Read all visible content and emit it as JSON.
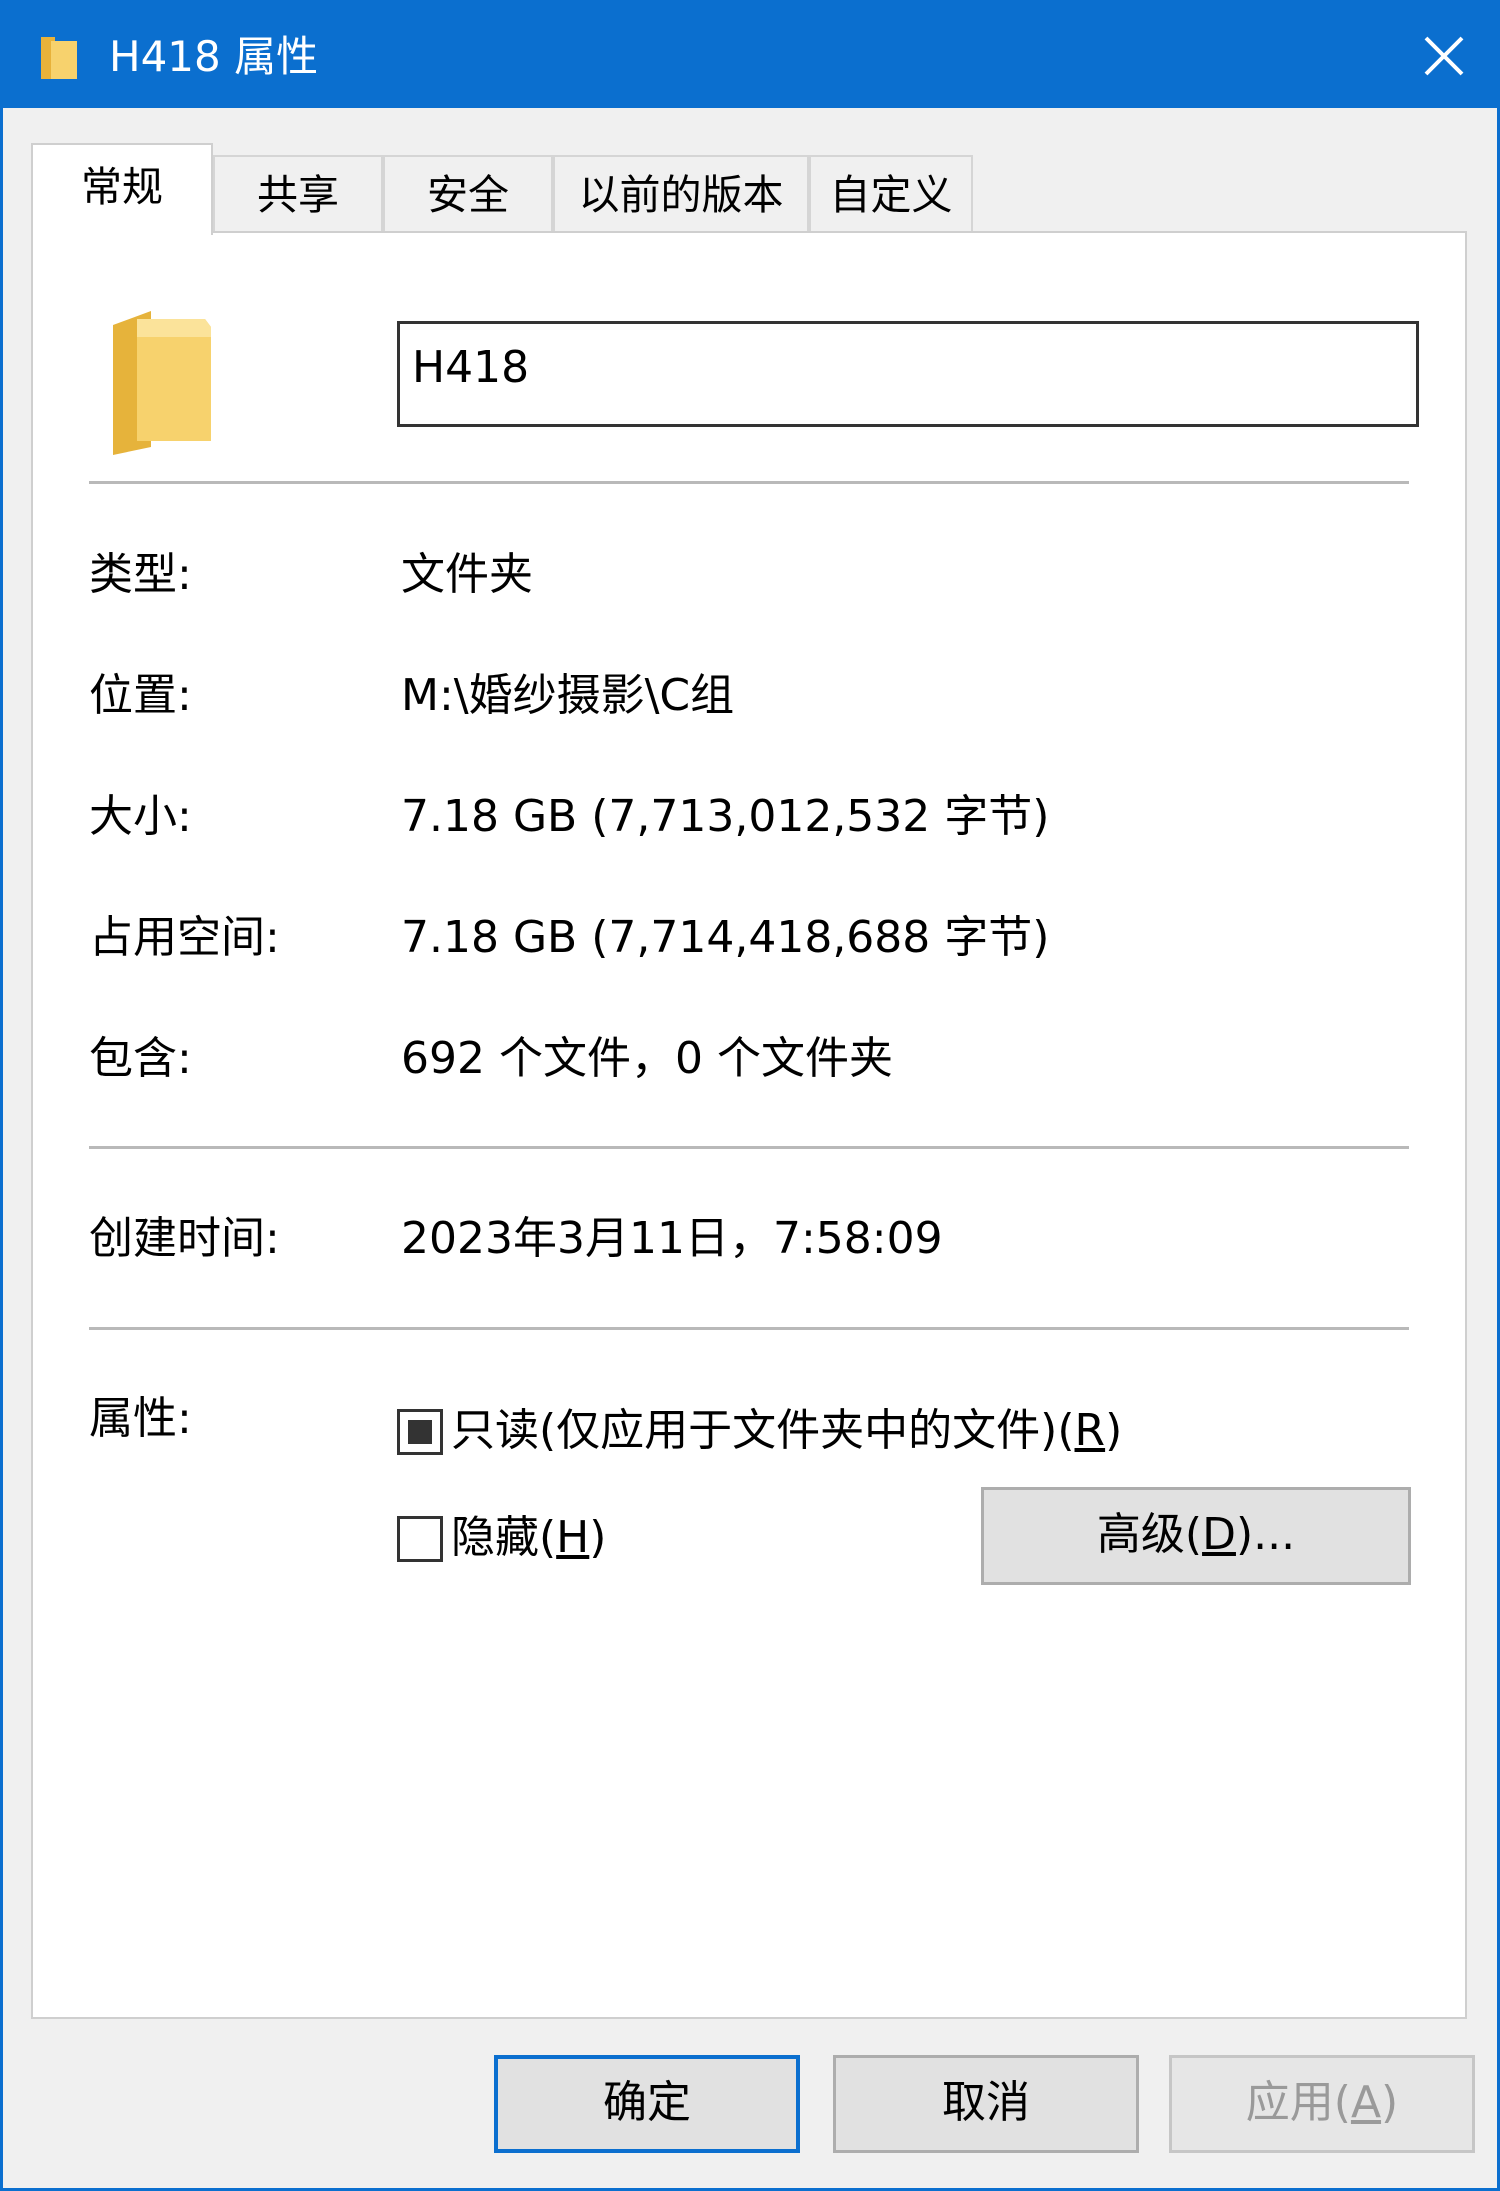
{
  "window": {
    "title": "H418 属性",
    "icons": {
      "title": "folder-icon",
      "close": "close-icon",
      "folder": "folder-icon"
    },
    "colors": {
      "accent": "#0b6fcf",
      "panel": "#ffffff",
      "chrome": "#f0f0f0",
      "folder": "#f7d26d"
    }
  },
  "tabs": [
    {
      "label": "常规",
      "active": true
    },
    {
      "label": "共享",
      "active": false
    },
    {
      "label": "安全",
      "active": false
    },
    {
      "label": "以前的版本",
      "active": false
    },
    {
      "label": "自定义",
      "active": false
    }
  ],
  "general": {
    "name_value": "H418",
    "rows": [
      {
        "label": "类型:",
        "value": "文件夹"
      },
      {
        "label": "位置:",
        "value": "M:\\婚纱摄影\\C组"
      },
      {
        "label": "大小:",
        "value": "7.18 GB (7,713,012,532 字节)"
      },
      {
        "label": "占用空间:",
        "value": "7.18 GB (7,714,418,688 字节)"
      },
      {
        "label": "包含:",
        "value": "692 个文件，0 个文件夹"
      }
    ],
    "created": {
      "label": "创建时间:",
      "value": "2023年3月11日，7:58:09"
    },
    "attributes": {
      "label": "属性:",
      "readonly_label": "只读(仅应用于文件夹中的文件)",
      "readonly_key": "R",
      "readonly_state": "indeterminate",
      "hidden_label": "隐藏",
      "hidden_key": "H",
      "hidden_checked": false,
      "advanced_label": "高级",
      "advanced_key": "D",
      "advanced_suffix": "..."
    }
  },
  "footer": {
    "ok": "确定",
    "cancel": "取消",
    "apply_label": "应用",
    "apply_key": "A",
    "apply_enabled": false
  }
}
